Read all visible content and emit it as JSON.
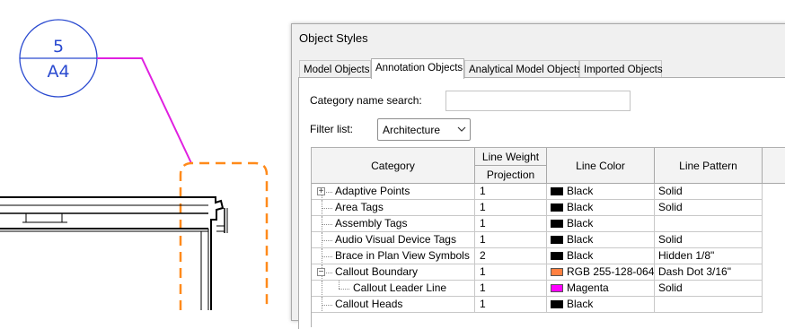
{
  "drawing": {
    "callout_number": "5",
    "callout_sheet": "A4",
    "colors": {
      "callout_circle": "#2a4ad0",
      "leader_line": "#e020e0",
      "callout_boundary": "#ff8020",
      "walls": "#000000"
    }
  },
  "dialog": {
    "title": "Object Styles",
    "tabs": [
      {
        "label": "Model Objects",
        "active": false
      },
      {
        "label": "Annotation Objects",
        "active": true
      },
      {
        "label": "Analytical Model Objects",
        "active": false
      },
      {
        "label": "Imported Objects",
        "active": false
      }
    ],
    "category_search": {
      "label": "Category name search:",
      "value": ""
    },
    "filter": {
      "label": "Filter list:",
      "value": "Architecture"
    },
    "table": {
      "headers": {
        "category": "Category",
        "line_weight": "Line Weight",
        "projection": "Projection",
        "line_color": "Line Color",
        "line_pattern": "Line Pattern"
      },
      "rows": [
        {
          "category": "Adaptive Points",
          "projection": "1",
          "color_name": "Black",
          "color_hex": "#000000",
          "pattern": "Solid",
          "level": 0,
          "expander": "+"
        },
        {
          "category": "Area Tags",
          "projection": "1",
          "color_name": "Black",
          "color_hex": "#000000",
          "pattern": "Solid",
          "level": 0,
          "expander": ""
        },
        {
          "category": "Assembly Tags",
          "projection": "1",
          "color_name": "Black",
          "color_hex": "#000000",
          "pattern": "",
          "level": 0,
          "expander": ""
        },
        {
          "category": "Audio Visual Device Tags",
          "projection": "1",
          "color_name": "Black",
          "color_hex": "#000000",
          "pattern": "Solid",
          "level": 0,
          "expander": ""
        },
        {
          "category": "Brace in Plan View Symbols",
          "projection": "2",
          "color_name": "Black",
          "color_hex": "#000000",
          "pattern": "Hidden 1/8\"",
          "level": 0,
          "expander": ""
        },
        {
          "category": "Callout Boundary",
          "projection": "1",
          "color_name": "RGB 255-128-064",
          "color_hex": "#ff8040",
          "pattern": "Dash Dot 3/16\"",
          "level": 0,
          "expander": "−"
        },
        {
          "category": "Callout Leader Line",
          "projection": "1",
          "color_name": "Magenta",
          "color_hex": "#ff00ff",
          "pattern": "Solid",
          "level": 1,
          "expander": ""
        },
        {
          "category": "Callout Heads",
          "projection": "1",
          "color_name": "Black",
          "color_hex": "#000000",
          "pattern": "",
          "level": 0,
          "expander": ""
        }
      ]
    }
  }
}
